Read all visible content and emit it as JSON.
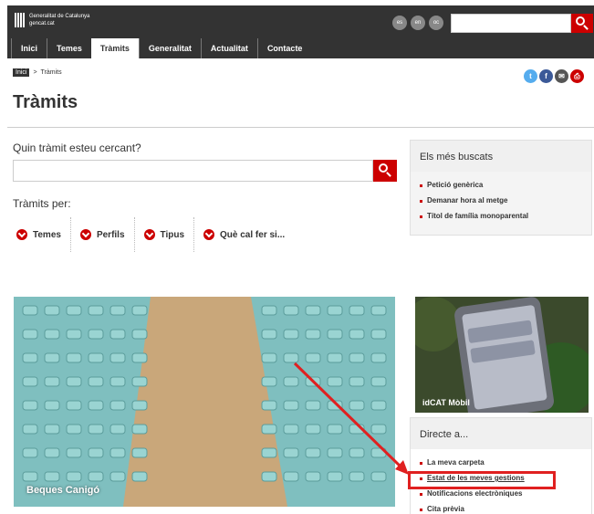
{
  "header": {
    "logo_line1": "Generalitat de Catalunya",
    "logo_line2": "gencat.cat",
    "languages": [
      "es",
      "en",
      "oc"
    ],
    "nav": [
      "Inici",
      "Temes",
      "Tràmits",
      "Generalitat",
      "Actualitat",
      "Contacte"
    ],
    "active_nav": "Tràmits"
  },
  "breadcrumb": {
    "home": "Inici",
    "separator": ">",
    "current": "Tràmits"
  },
  "share_icons": [
    "twitter-icon",
    "facebook-icon",
    "email-icon",
    "print-icon"
  ],
  "page_title": "Tràmits",
  "search": {
    "label": "Quin tràmit esteu cercant?",
    "value": "",
    "placeholder": ""
  },
  "filters": {
    "label": "Tràmits per:",
    "items": [
      "Temes",
      "Perfils",
      "Tipus",
      "Què cal fer si..."
    ]
  },
  "most_searched": {
    "title": "Els més buscats",
    "items": [
      "Petició genèrica",
      "Demanar hora al metge",
      "Títol de família monoparental"
    ]
  },
  "hero": {
    "caption": "Beques Canigó"
  },
  "side_promo": {
    "caption": "idCAT Mòbil"
  },
  "direct": {
    "title": "Directe a...",
    "items": [
      "La meva carpeta",
      "Estat de les meves gestions",
      "Notificacions electròniques",
      "Cita prèvia"
    ]
  },
  "colors": {
    "brand_red": "#cc0000",
    "header_bg": "#333333",
    "annotation_red": "#e02020"
  }
}
